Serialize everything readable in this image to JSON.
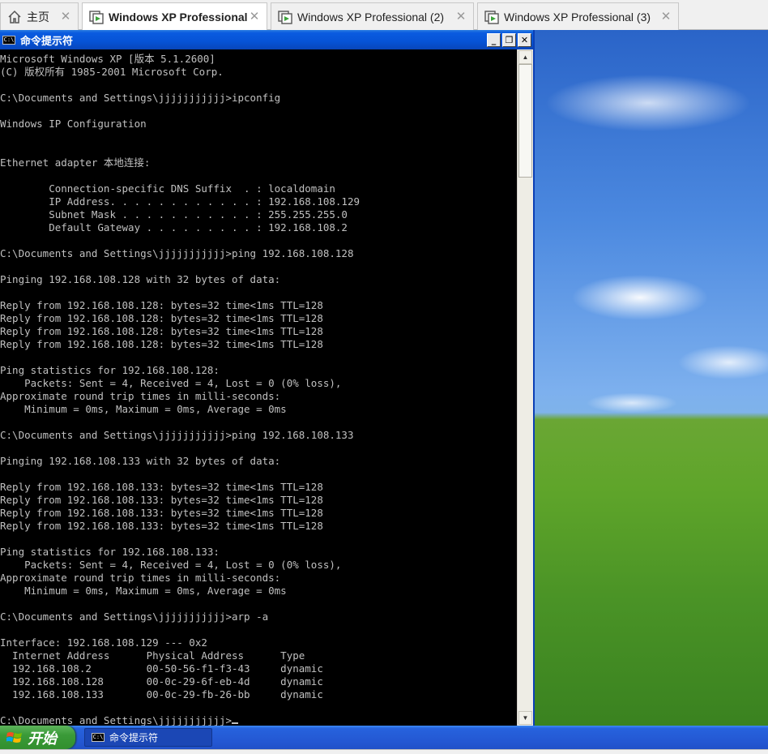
{
  "host_tabs": [
    {
      "label": "主页",
      "icon": "home-icon"
    },
    {
      "label": "Windows XP Professional",
      "icon": "vm-icon",
      "active": true
    },
    {
      "label": "Windows XP Professional (2)",
      "icon": "vm-icon"
    },
    {
      "label": "Windows XP Professional (3)",
      "icon": "vm-icon"
    }
  ],
  "window": {
    "title": "命令提示符",
    "icon_text": "C:\\",
    "minimize_glyph": "_",
    "maximize_glyph": "❐",
    "close_glyph": "✕"
  },
  "console": {
    "lines": [
      "Microsoft Windows XP [版本 5.1.2600]",
      "(C) 版权所有 1985-2001 Microsoft Corp.",
      "",
      "C:\\Documents and Settings\\jjjjjjjjjjj>ipconfig",
      "",
      "Windows IP Configuration",
      "",
      "",
      "Ethernet adapter 本地连接:",
      "",
      "        Connection-specific DNS Suffix  . : localdomain",
      "        IP Address. . . . . . . . . . . . : 192.168.108.129",
      "        Subnet Mask . . . . . . . . . . . : 255.255.255.0",
      "        Default Gateway . . . . . . . . . : 192.168.108.2",
      "",
      "C:\\Documents and Settings\\jjjjjjjjjjj>ping 192.168.108.128",
      "",
      "Pinging 192.168.108.128 with 32 bytes of data:",
      "",
      "Reply from 192.168.108.128: bytes=32 time<1ms TTL=128",
      "Reply from 192.168.108.128: bytes=32 time<1ms TTL=128",
      "Reply from 192.168.108.128: bytes=32 time<1ms TTL=128",
      "Reply from 192.168.108.128: bytes=32 time<1ms TTL=128",
      "",
      "Ping statistics for 192.168.108.128:",
      "    Packets: Sent = 4, Received = 4, Lost = 0 (0% loss),",
      "Approximate round trip times in milli-seconds:",
      "    Minimum = 0ms, Maximum = 0ms, Average = 0ms",
      "",
      "C:\\Documents and Settings\\jjjjjjjjjjj>ping 192.168.108.133",
      "",
      "Pinging 192.168.108.133 with 32 bytes of data:",
      "",
      "Reply from 192.168.108.133: bytes=32 time<1ms TTL=128",
      "Reply from 192.168.108.133: bytes=32 time<1ms TTL=128",
      "Reply from 192.168.108.133: bytes=32 time<1ms TTL=128",
      "Reply from 192.168.108.133: bytes=32 time<1ms TTL=128",
      "",
      "Ping statistics for 192.168.108.133:",
      "    Packets: Sent = 4, Received = 4, Lost = 0 (0% loss),",
      "Approximate round trip times in milli-seconds:",
      "    Minimum = 0ms, Maximum = 0ms, Average = 0ms",
      "",
      "C:\\Documents and Settings\\jjjjjjjjjjj>arp -a",
      "",
      "Interface: 192.168.108.129 --- 0x2",
      "  Internet Address      Physical Address      Type",
      "  192.168.108.2         00-50-56-f1-f3-43     dynamic",
      "  192.168.108.128       00-0c-29-6f-eb-4d     dynamic",
      "  192.168.108.133       00-0c-29-fb-26-bb     dynamic",
      "",
      "C:\\Documents and Settings\\jjjjjjjjjjj>"
    ]
  },
  "taskbar": {
    "start_label": "开始",
    "task_item_label": "命令提示符",
    "task_item_icon_text": "C:\\"
  },
  "colors": {
    "console_bg": "#000000",
    "console_fg": "#c0c0c0",
    "titlebar_blue": "#0653d6",
    "taskbar_blue": "#2457d2",
    "start_green": "#3a9a38"
  }
}
